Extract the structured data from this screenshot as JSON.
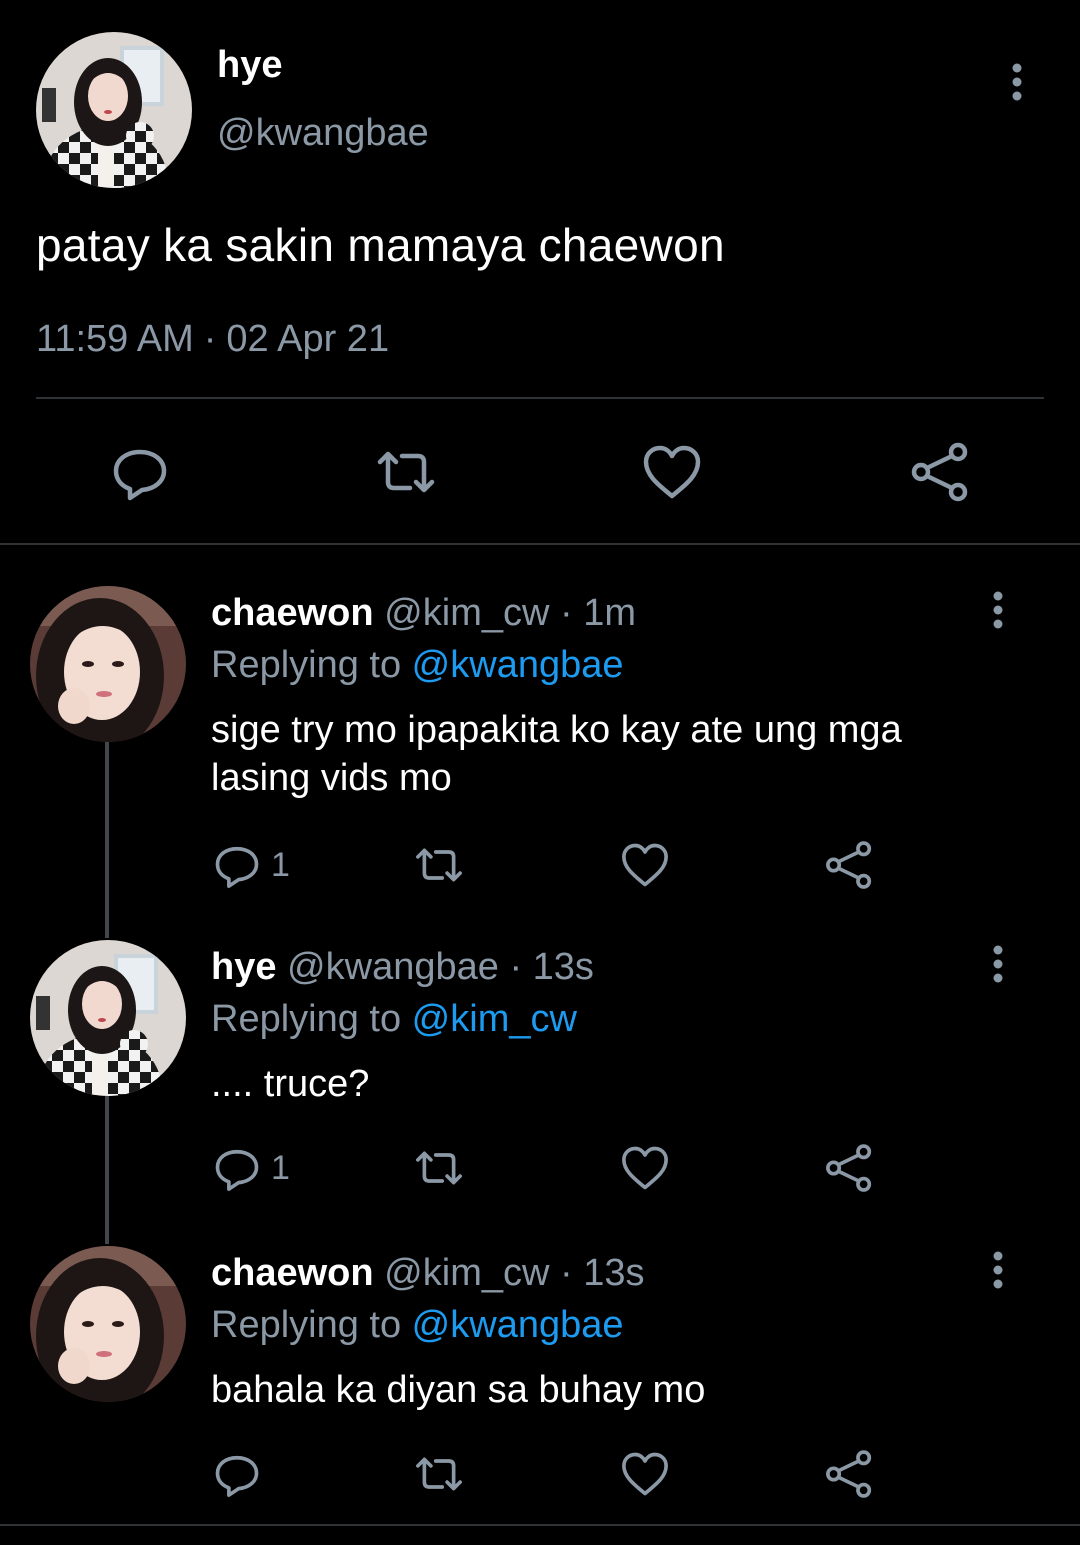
{
  "main_tweet": {
    "name": "hye",
    "handle": "@kwangbae",
    "text": "patay ka sakin mamaya chaewon",
    "time": "11:59 AM",
    "separator": "·",
    "date": "02 Apr 21",
    "actions": [
      "reply-icon",
      "retweet-icon",
      "like-icon",
      "share-icon"
    ]
  },
  "replies": [
    {
      "name": "chaewon",
      "handle": "@kim_cw",
      "dot": "·",
      "time": "1m",
      "replying_prefix": "Replying to ",
      "replying_to": "@kwangbae",
      "text": "sige try mo ipapakita ko kay ate ung mga lasing vids mo",
      "reply_count": "1"
    },
    {
      "name": "hye",
      "handle": "@kwangbae",
      "dot": "·",
      "time": "13s",
      "replying_prefix": "Replying to ",
      "replying_to": "@kim_cw",
      "text": ".... truce?",
      "reply_count": "1"
    },
    {
      "name": "chaewon",
      "handle": "@kim_cw",
      "dot": "·",
      "time": "13s",
      "replying_prefix": "Replying to ",
      "replying_to": "@kwangbae",
      "text": "bahala ka diyan sa buhay mo",
      "reply_count": ""
    }
  ],
  "colors": {
    "background": "#000000",
    "text": "#ffffff",
    "secondary": "#8b98a5",
    "mention": "#1d9bf0",
    "divider": "#2f3336"
  }
}
